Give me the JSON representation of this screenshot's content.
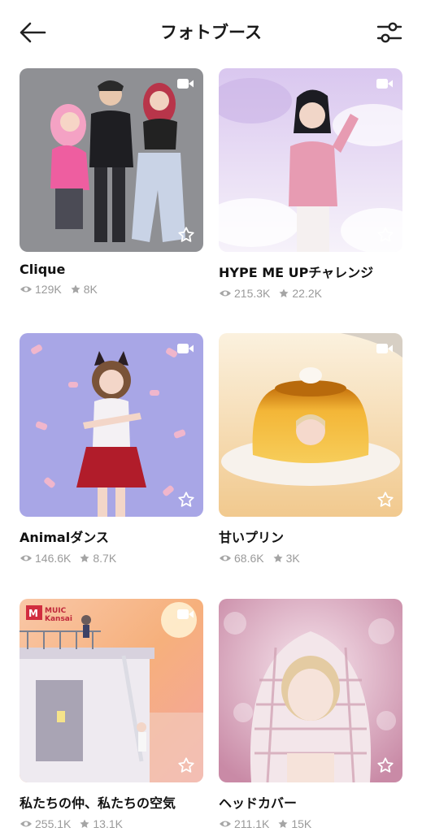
{
  "header": {
    "title": "フォトブース",
    "back_icon": "arrow-left-icon",
    "filter_icon": "sliders-icon"
  },
  "booths": [
    {
      "name": "Clique",
      "views": "129K",
      "favorites": "8K"
    },
    {
      "name": "HYPE ME UPチャレンジ",
      "views": "215.3K",
      "favorites": "22.2K"
    },
    {
      "name": "Animalダンス",
      "views": "146.6K",
      "favorites": "8.7K"
    },
    {
      "name": "甘いプリン",
      "views": "68.6K",
      "favorites": "3K"
    },
    {
      "name": "私たちの仲、私たちの空気",
      "views": "255.1K",
      "favorites": "13.1K",
      "logo_text": "MUIC Kansai"
    },
    {
      "name": "ヘッドカバー",
      "views": "211.1K",
      "favorites": "15K"
    }
  ],
  "colors": {
    "text": "#111111",
    "meta": "#9a9a9a",
    "icon_white": "#ffffff"
  }
}
